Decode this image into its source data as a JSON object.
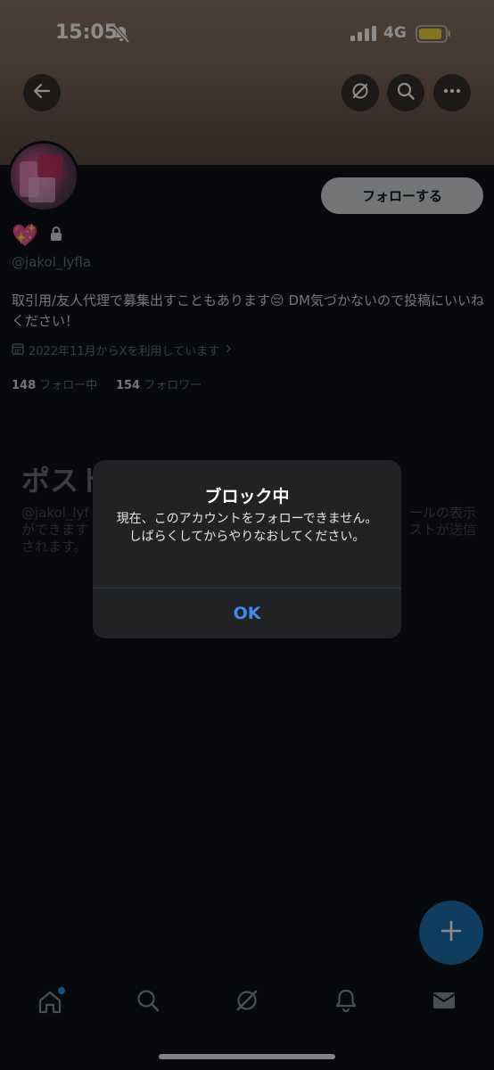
{
  "status_bar": {
    "time": "15:05",
    "network": "4G",
    "battery_color": "#f5d63a"
  },
  "header": {
    "back_icon": "arrow-left-icon",
    "actions": [
      "grok-icon",
      "search-icon",
      "more-icon"
    ]
  },
  "profile": {
    "follow_label": "フォローする",
    "name_emoji": "💖",
    "handle": "@jakol_lyfla",
    "bio": "取引用/友人代理で募集出すこともあります😔 DM気づかないので投稿にいいねください！",
    "joined": "2022年11月からXを利用しています",
    "following_count": "148",
    "following_label": "フォロー中",
    "followers_count": "154",
    "followers_label": "フォロワー"
  },
  "posts": {
    "title": "ポスト",
    "subtitle_left": "@jakol_lyf",
    "subtitle_right": "ールの表示",
    "line2_left": "ができます",
    "line2_right": "ストが送信",
    "line3": "されます。"
  },
  "dialog": {
    "title": "ブロック中",
    "message": "現在、このアカウントをフォローできません。しばらくしてからやりなおしてください。",
    "ok_label": "OK",
    "ok_color": "#3b8cf0"
  },
  "tabbar": {
    "tabs": [
      "home-icon",
      "search-icon",
      "grok-icon",
      "notifications-icon",
      "messages-icon"
    ],
    "accent": "#1d9bf0"
  }
}
